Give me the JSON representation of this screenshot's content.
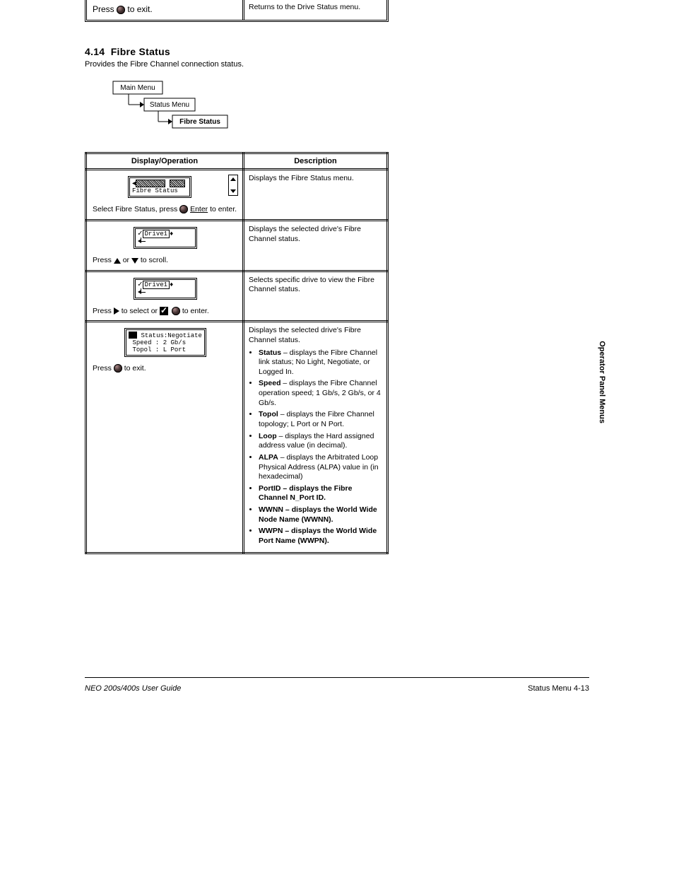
{
  "top_row": {
    "left_prefix": "Press ",
    "left_suffix": " to exit.",
    "right": "Returns to the Drive Status menu."
  },
  "section": {
    "number": "4.14",
    "title": "Fibre Status",
    "subtext": "Provides the Fibre Channel connection status."
  },
  "breadcrumb": {
    "a": "Main Menu",
    "b": "Status Menu",
    "c": "Fibre Status"
  },
  "table": {
    "hdr_left": "Display/Operation",
    "hdr_right": "Description",
    "rows": [
      {
        "lcd_text": "Fibre Status",
        "op_prefix": "Select Fibre Status, press ",
        "op_suffix": " to enter.",
        "button_text": "Enter",
        "right": "Displays the Fibre Status menu."
      },
      {
        "lcd_text": "Drive1",
        "op_prefix": "Press ",
        "op_mid": " or ",
        "op_suffix": " to scroll.",
        "right": "Displays the selected drive's Fibre Channel status."
      },
      {
        "lcd_text": "Drive1",
        "op_prefix": "Press ",
        "op_mid": " to select or ",
        "op_suffix": " to enter.",
        "right": "Selects specific drive to view the Fibre Channel status."
      },
      {
        "lcd_lines": [
          "Status:Negotiate",
          "Speed : 2 Gb/s",
          "Topol : L Port"
        ],
        "op_prefix": "Press ",
        "op_suffix": " to exit.",
        "right_lead": "Displays the selected drive's Fibre Channel status.",
        "right_lines": [
          {
            "label": "Status",
            "body": "displays the Fibre Channel link status; No Light, Negotiate, or Logged In."
          },
          {
            "label": "Speed",
            "body": "displays the Fibre Channel operation speed; 1 Gb/s, 2 Gb/s, or 4 Gb/s."
          },
          {
            "label": "Topol",
            "body": "displays the Fibre Channel topology; L Port or N Port."
          },
          {
            "label": "Loop",
            "body": "displays the Hard assigned address value (in decimal)."
          },
          {
            "label": "ALPA",
            "body": "displays the Arbitrated Loop Physical Address (ALPA) value in (in hexadecimal)"
          },
          {
            "label": "PortID",
            "body": "displays the Fibre Channel N_Port ID."
          },
          {
            "label": "WWNN",
            "body": "displays the World Wide Node Name (WWNN)."
          },
          {
            "label": "WWPN",
            "body": "displays the World Wide Port Name (WWPN)."
          }
        ]
      }
    ]
  },
  "footer": {
    "left": "NEO 200s/400s User Guide",
    "right": "Status Menu   4-13"
  },
  "tab": "Operator Panel Menus"
}
